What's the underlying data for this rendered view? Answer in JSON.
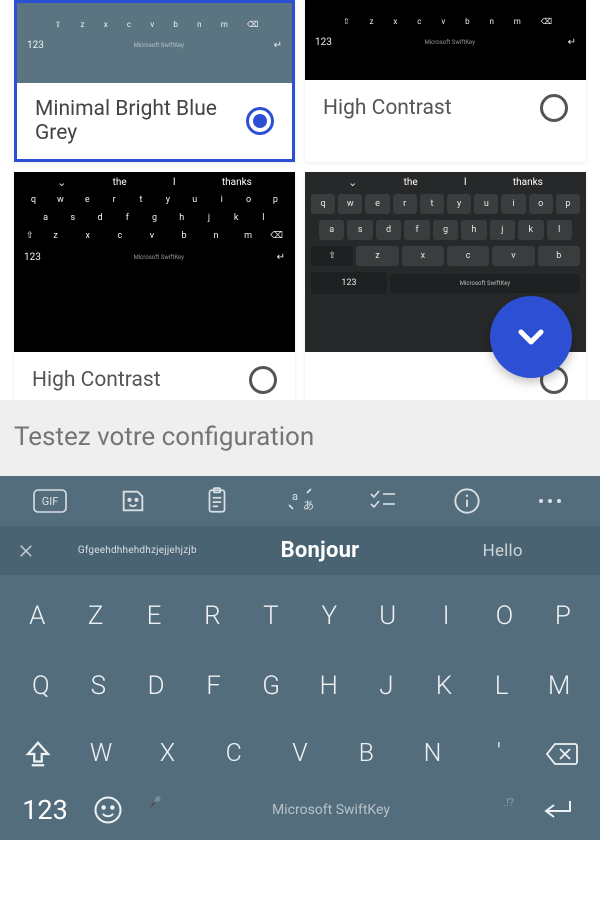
{
  "themes": [
    {
      "name": "Minimal Bright Blue Grey",
      "selected": true,
      "bgStyle": "bluegrey",
      "row3": [
        "z",
        "x",
        "c",
        "v",
        "b",
        "n",
        "m"
      ],
      "num": "123",
      "brand": "Microsoft SwiftKey"
    },
    {
      "name": "High Contrast",
      "selected": false,
      "bgStyle": "black",
      "row3": [
        "z",
        "x",
        "c",
        "v",
        "b",
        "n",
        "m"
      ],
      "num": "123",
      "brand": "Microsoft SwiftKey"
    },
    {
      "name": "High Contrast",
      "selected": false,
      "bgStyle": "black",
      "suggestions": [
        "the",
        "I",
        "thanks"
      ],
      "row1": [
        "q",
        "w",
        "e",
        "r",
        "t",
        "y",
        "u",
        "i",
        "o",
        "p"
      ],
      "row2": [
        "a",
        "s",
        "d",
        "f",
        "g",
        "h",
        "j",
        "k",
        "l"
      ],
      "row3": [
        "z",
        "x",
        "c",
        "v",
        "b",
        "n",
        "m"
      ],
      "num": "123",
      "brand": "Microsoft SwiftKey"
    },
    {
      "name": "",
      "selected": false,
      "bgStyle": "darkkeys",
      "suggestions": [
        "the",
        "I",
        "thanks"
      ],
      "row1": [
        "q",
        "w",
        "e",
        "r",
        "t",
        "y",
        "u",
        "i",
        "o",
        "p"
      ],
      "row2": [
        "a",
        "s",
        "d",
        "f",
        "g",
        "h",
        "j",
        "k",
        "l"
      ],
      "row3": [
        "z",
        "x",
        "c",
        "v",
        "b"
      ],
      "num": "123",
      "brand": "Microsoft SwiftKey"
    }
  ],
  "input": {
    "placeholder": "Testez votre configuration",
    "value": ""
  },
  "toolbar_icons": [
    "gif",
    "sticker",
    "clipboard",
    "translate",
    "tasks",
    "info",
    "more"
  ],
  "suggestions": {
    "s1": "Gfgeehdhhehdhzjejjehjzjb",
    "s2": "Bonjour",
    "s3": "Hello"
  },
  "keyboard": {
    "row1": [
      "A",
      "Z",
      "E",
      "R",
      "T",
      "Y",
      "U",
      "I",
      "O",
      "P"
    ],
    "row2": [
      "Q",
      "S",
      "D",
      "F",
      "G",
      "H",
      "J",
      "K",
      "L",
      "M"
    ],
    "row3": [
      "W",
      "X",
      "C",
      "V",
      "B",
      "N",
      "'"
    ],
    "num_label": "123",
    "space_brand": "Microsoft SwiftKey",
    "mic_hint": "🎤",
    "punct_hint": ".!?"
  },
  "colors": {
    "accent": "#2d4fd4",
    "kb_bg": "#546d7c",
    "kb_sug_bg": "#4a6372"
  }
}
